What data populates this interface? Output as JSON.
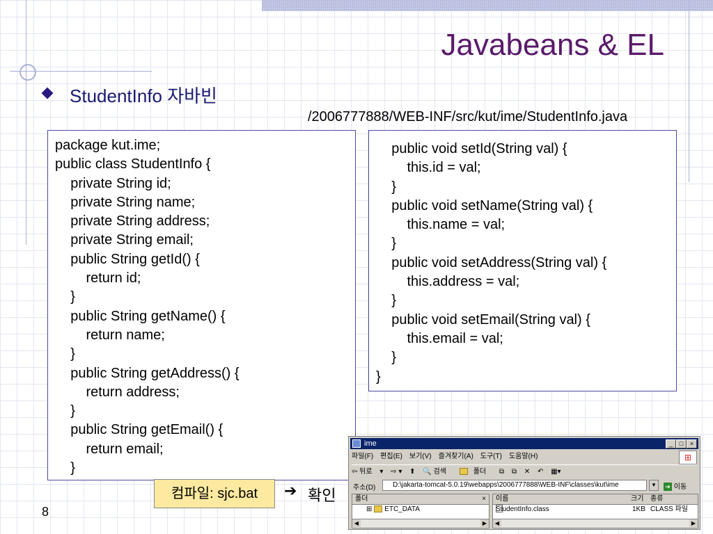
{
  "slide": {
    "title": "Javabeans & EL",
    "bullet": "StudentInfo 자바빈",
    "path": "/2006777888/WEB-INF/src/kut/ime/StudentInfo.java",
    "page_number": "8"
  },
  "code_left": [
    "package kut.ime;",
    "public class StudentInfo {",
    "    private String id;",
    "    private String name;",
    "    private String address;",
    "    private String email;",
    "    public String getId() {",
    "        return id;",
    "    }",
    "    public String getName() {",
    "        return name;",
    "    }",
    "    public String getAddress() {",
    "        return address;",
    "    }",
    "    public String getEmail() {",
    "        return email;",
    "    }"
  ],
  "code_right": [
    "    public void setId(String val) {",
    "        this.id = val;",
    "    }",
    "    public void setName(String val) {",
    "        this.name = val;",
    "    }",
    "    public void setAddress(String val) {",
    "        this.address = val;",
    "    }",
    "    public void setEmail(String val) {",
    "        this.email = val;",
    "    }",
    "}"
  ],
  "compile_note": "컴파일: sjc.bat",
  "confirm_label": "확인",
  "explorer": {
    "title": "ime",
    "menu": [
      "파일(F)",
      "편집(E)",
      "보기(V)",
      "즐겨찾기(A)",
      "도구(T)",
      "도움말(H)"
    ],
    "toolbar": {
      "back": "뒤로",
      "search": "검색",
      "folders": "폴더"
    },
    "address_label": "주소(D)",
    "address_value": "D:\\jakarta-tomcat-5.0.19\\webapps\\2006777888\\WEB-INF\\classes\\kut\\ime",
    "go_label": "이동",
    "left_panel": {
      "header": "폴더",
      "close": "×",
      "items": [
        "ETC_DATA"
      ]
    },
    "right_panel": {
      "columns": {
        "name": "이름",
        "size": "크기",
        "type": "종류"
      },
      "files": [
        {
          "name": "StudentInfo.class",
          "size": "1KB",
          "type": "CLASS 파일"
        }
      ]
    }
  }
}
